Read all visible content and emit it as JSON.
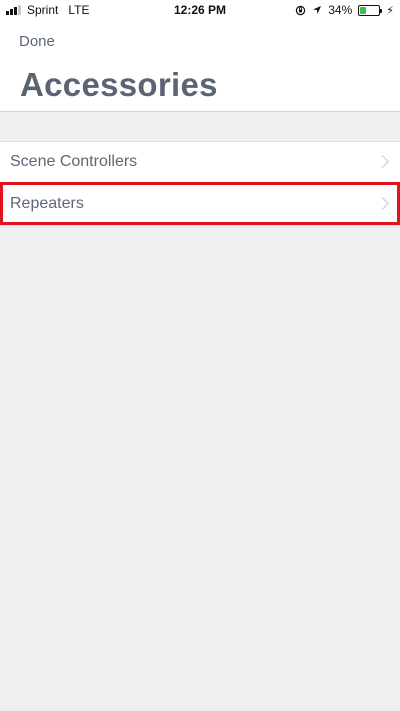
{
  "status_bar": {
    "carrier": "Sprint",
    "network": "LTE",
    "time": "12:26 PM",
    "battery_percent": "34%",
    "battery_level": 0.34,
    "battery_color": "#35c24a",
    "icons": [
      "signal-icon",
      "lock-rotation-icon",
      "location-arrow-icon",
      "battery-icon",
      "charging-bolt-icon"
    ]
  },
  "nav": {
    "done_label": "Done",
    "title": "Accessories"
  },
  "list": {
    "items": [
      {
        "label": "Scene Controllers"
      },
      {
        "label": "Repeaters",
        "highlighted": true
      }
    ]
  },
  "colors": {
    "highlight": "#e0141e",
    "background": "#efefef",
    "text": "#5a6573"
  }
}
